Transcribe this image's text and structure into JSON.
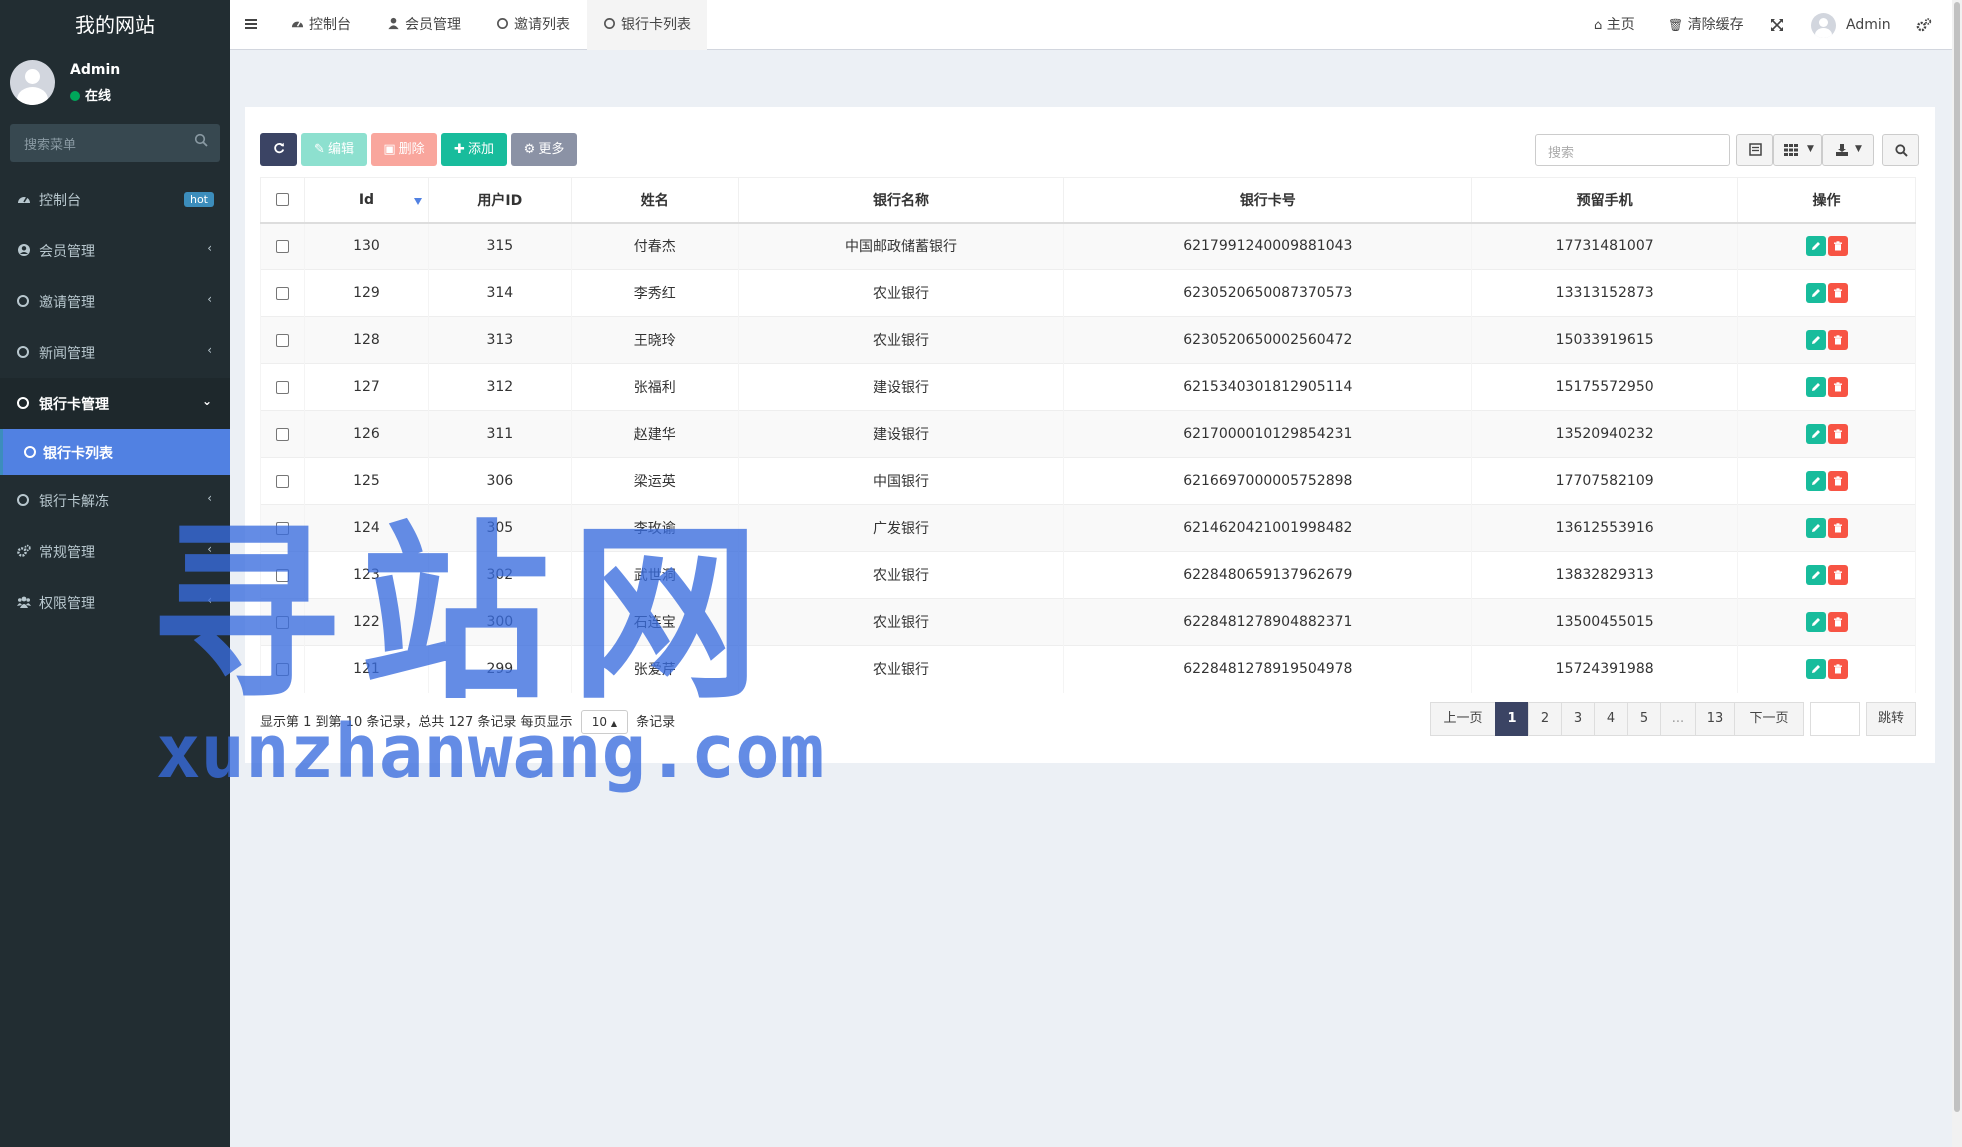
{
  "site_title": "我的网站",
  "user": {
    "name": "Admin",
    "status": "在线"
  },
  "sidebar_search": {
    "placeholder": "搜索菜单"
  },
  "menu": [
    {
      "label": "控制台",
      "icon": "dashboard-icon",
      "badge": "hot"
    },
    {
      "label": "会员管理",
      "icon": "user-circle-icon",
      "arrow": "‹"
    },
    {
      "label": "邀请管理",
      "icon": "circle-icon",
      "arrow": "‹"
    },
    {
      "label": "新闻管理",
      "icon": "circle-icon",
      "arrow": "‹"
    },
    {
      "label": "银行卡管理",
      "icon": "circle-icon",
      "arrow": "⌄"
    },
    {
      "label": "银行卡列表",
      "icon": "circle-icon"
    },
    {
      "label": "银行卡解冻",
      "icon": "circle-icon",
      "arrow": "‹"
    },
    {
      "label": "常规管理",
      "icon": "cogs-icon",
      "arrow": "‹"
    },
    {
      "label": "权限管理",
      "icon": "users-icon",
      "arrow": "‹"
    }
  ],
  "tabs": [
    {
      "label": "控制台"
    },
    {
      "label": "会员管理"
    },
    {
      "label": "邀请列表"
    },
    {
      "label": "银行卡列表"
    }
  ],
  "topright": {
    "home": "主页",
    "clear_cache": "清除缓存",
    "admin": "Admin"
  },
  "toolbar": {
    "edit": "编辑",
    "delete": "删除",
    "add": "添加",
    "more": "更多",
    "search_placeholder": "搜索"
  },
  "table": {
    "columns": [
      "Id",
      "用户ID",
      "姓名",
      "银行名称",
      "银行卡号",
      "预留手机",
      "操作"
    ],
    "rows": [
      {
        "id": "130",
        "uid": "315",
        "name": "付春杰",
        "bank": "中国邮政储蓄银行",
        "card": "6217991240009881043",
        "phone": "17731481007"
      },
      {
        "id": "129",
        "uid": "314",
        "name": "李秀红",
        "bank": "农业银行",
        "card": "6230520650087370573",
        "phone": "13313152873"
      },
      {
        "id": "128",
        "uid": "313",
        "name": "王晓玲",
        "bank": "农业银行",
        "card": "6230520650002560472",
        "phone": "15033919615"
      },
      {
        "id": "127",
        "uid": "312",
        "name": "张福利",
        "bank": "建设银行",
        "card": "6215340301812905114",
        "phone": "15175572950"
      },
      {
        "id": "126",
        "uid": "311",
        "name": "赵建华",
        "bank": "建设银行",
        "card": "6217000010129854231",
        "phone": "13520940232"
      },
      {
        "id": "125",
        "uid": "306",
        "name": "梁运英",
        "bank": "中国银行",
        "card": "6216697000005752898",
        "phone": "17707582109"
      },
      {
        "id": "124",
        "uid": "305",
        "name": "李玫谕",
        "bank": "广发银行",
        "card": "6214620421001998482",
        "phone": "13612553916"
      },
      {
        "id": "123",
        "uid": "302",
        "name": "武世洞",
        "bank": "农业银行",
        "card": "6228480659137962679",
        "phone": "13832829313"
      },
      {
        "id": "122",
        "uid": "300",
        "name": "石连宝",
        "bank": "农业银行",
        "card": "6228481278904882371",
        "phone": "13500455015"
      },
      {
        "id": "121",
        "uid": "299",
        "name": "张爱芹",
        "bank": "农业银行",
        "card": "6228481278919504978",
        "phone": "15724391988"
      }
    ]
  },
  "footer": {
    "info_prefix": "显示第 1 到第 10 条记录，总共 127 条记录 每页显示",
    "page_size": "10",
    "info_suffix": "条记录"
  },
  "pagination": {
    "prev": "上一页",
    "pages": [
      "1",
      "2",
      "3",
      "4",
      "5",
      "...",
      "13"
    ],
    "next": "下一页",
    "jump": "跳转"
  },
  "watermark": {
    "cn": "寻站网",
    "en": "xunzhanwang.com"
  },
  "colors": {
    "sidebar": "#222d32",
    "active": "#5181e2",
    "edit": "#18bc9c",
    "delete": "#f75444",
    "add": "#18bc9c",
    "refresh": "#3b4464"
  }
}
